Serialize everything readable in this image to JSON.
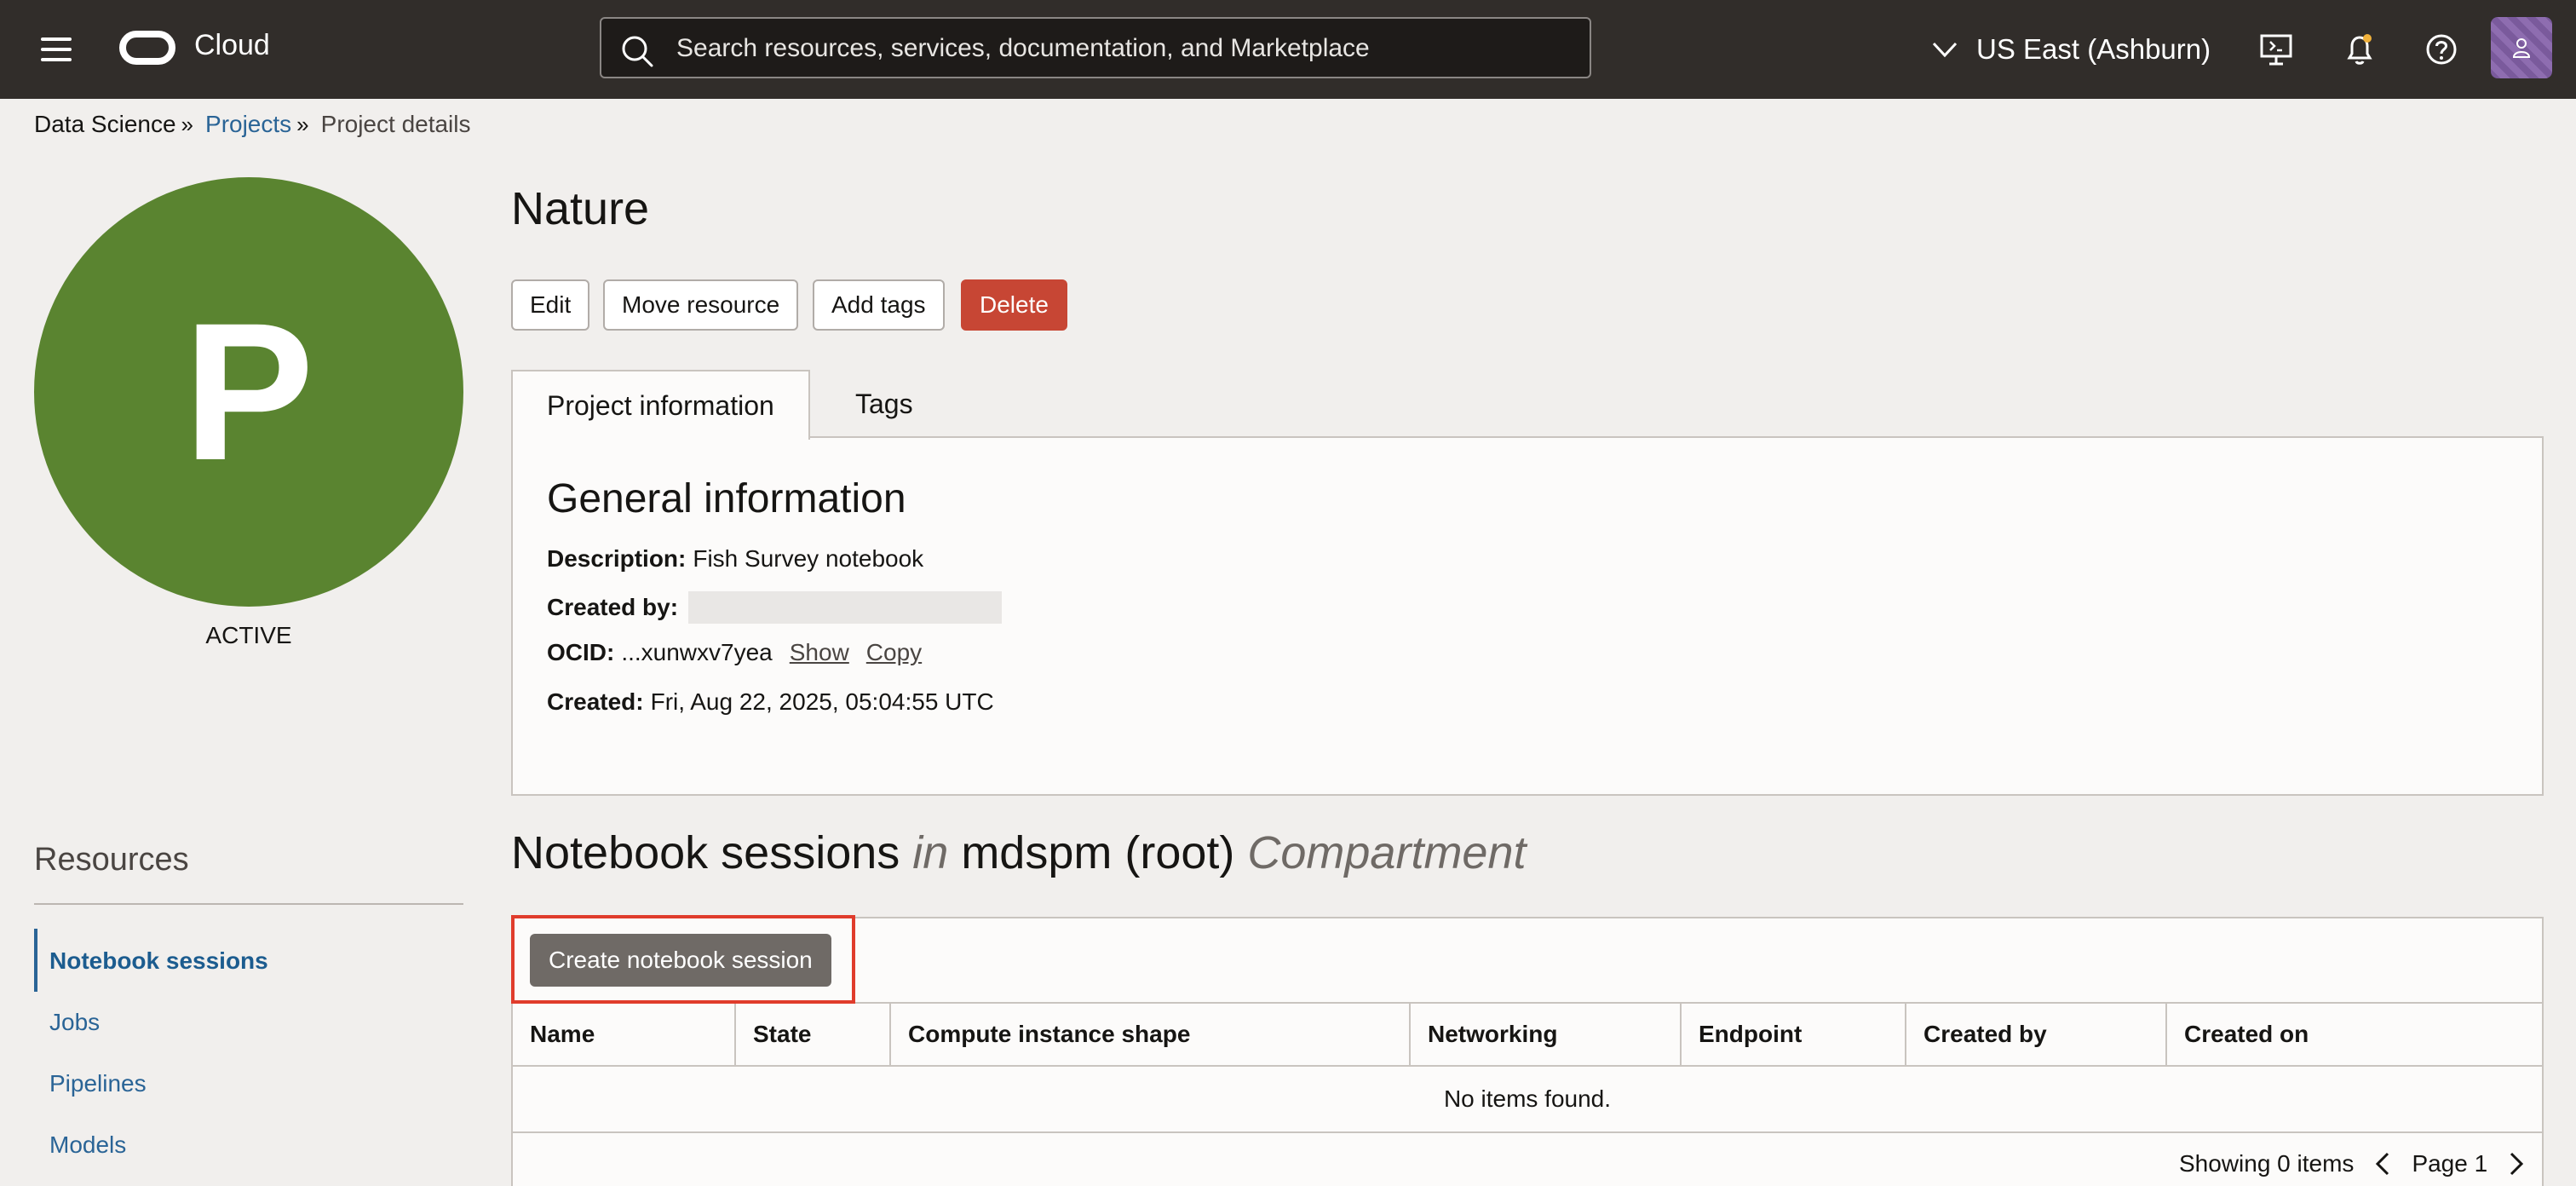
{
  "header": {
    "brand": "Cloud",
    "search_placeholder": "Search resources, services, documentation, and Marketplace",
    "region": "US East (Ashburn)"
  },
  "breadcrumb": {
    "root": "Data Science",
    "projects": "Projects",
    "current": "Project details"
  },
  "project": {
    "initial": "P",
    "state": "ACTIVE",
    "title": "Nature"
  },
  "actions": {
    "edit": "Edit",
    "move": "Move resource",
    "add_tags": "Add tags",
    "delete": "Delete"
  },
  "tabs": {
    "project_info": "Project information",
    "tags": "Tags"
  },
  "general": {
    "title": "General information",
    "description_label": "Description:",
    "description_value": "Fish Survey notebook",
    "created_by_label": "Created by:",
    "ocid_label": "OCID:",
    "ocid_value": "...xunwxv7yea",
    "show": "Show",
    "copy": "Copy",
    "created_label": "Created:",
    "created_value": "Fri, Aug 22, 2025, 05:04:55 UTC"
  },
  "resources": {
    "title": "Resources",
    "items": [
      "Notebook sessions",
      "Jobs",
      "Pipelines",
      "Models"
    ]
  },
  "notebooks": {
    "title_main": "Notebook sessions",
    "title_in": "in",
    "compartment": "mdspm (root)",
    "compartment_word": "Compartment",
    "create_button": "Create notebook session",
    "columns": [
      "Name",
      "State",
      "Compute instance shape",
      "Networking",
      "Endpoint",
      "Created by",
      "Created on"
    ],
    "empty_message": "No items found.",
    "showing": "Showing 0 items",
    "page": "Page 1"
  },
  "colors": {
    "topbar": "#312d2a",
    "avatar_circle": "#5a8430",
    "delete": "#c74634",
    "link": "#2a6496",
    "highlight": "#e03c2c"
  }
}
